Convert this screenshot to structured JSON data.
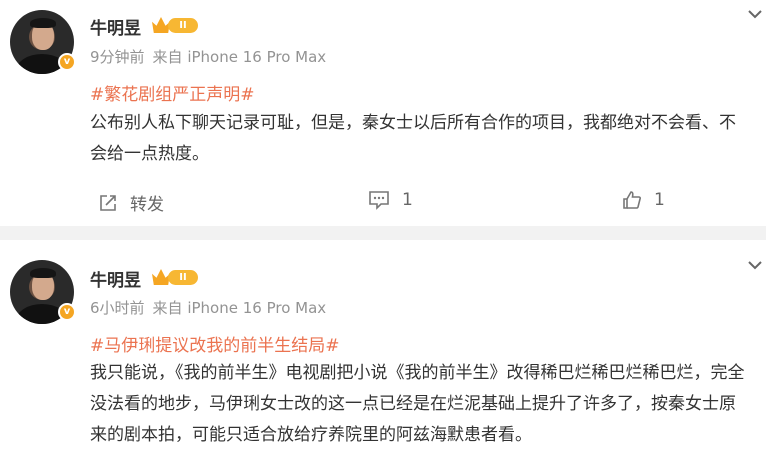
{
  "posts": [
    {
      "username": "牛明昱",
      "level_badge": "II",
      "time": "9分钟前",
      "source": "来自 iPhone 16 Pro Max",
      "topic": "#繁花剧组严正声明#",
      "content": "公布别人私下聊天记录可耻，但是，秦女士以后所有合作的项目，我都绝对不会看、不会给一点热度。",
      "actions": {
        "repost_label": "转发",
        "comment_count": "1",
        "like_count": "1"
      }
    },
    {
      "username": "牛明昱",
      "level_badge": "II",
      "time": "6小时前",
      "source": "来自 iPhone 16 Pro Max",
      "topic": "#马伊琍提议改我的前半生结局#",
      "content": "我只能说，《我的前半生》电视剧把小说《我的前半生》改得稀巴烂稀巴烂稀巴烂，完全没法看的地步，马伊琍女士改的这一点已经是在烂泥基础上提升了许多了，按秦女士原来的剧本拍，可能只适合放给疗养院里的阿兹海默患者看。"
    }
  ],
  "icons": {
    "verified": "verified-v-icon",
    "menu": "chevron-down-icon",
    "repost": "repost-icon",
    "comment": "comment-icon",
    "like": "thumbs-up-icon"
  },
  "colors": {
    "topic": "#eb7350",
    "meta": "#939393",
    "verified": "#f5a623",
    "separator": "#f2f2f2"
  }
}
